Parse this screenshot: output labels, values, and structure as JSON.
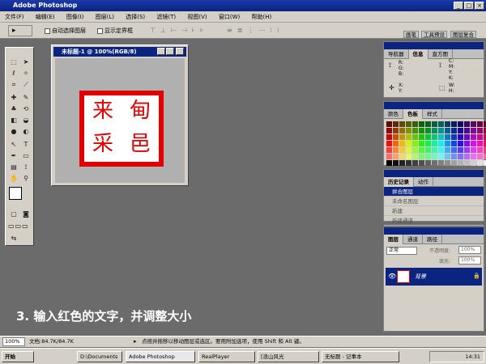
{
  "window": {
    "title": "Adobe Photoshop",
    "min": "_",
    "max": "□",
    "close": "×"
  },
  "menu": [
    "文件(F)",
    "编辑(E)",
    "图像(I)",
    "图层(L)",
    "选择(S)",
    "滤镜(T)",
    "视图(V)",
    "窗口(W)",
    "帮助(H)"
  ],
  "options": {
    "auto_select": "自动选择图层",
    "show_bounds": "显示定界框",
    "tabs": [
      "画笔",
      "工具预设",
      "图层复合"
    ]
  },
  "document": {
    "title": "未标题-1 @ 100%(RGB/8)",
    "seal_chars": [
      "来",
      "甸",
      "采",
      "邑"
    ]
  },
  "info_panel": {
    "tabs": [
      "导航器",
      "信息",
      "直方图"
    ],
    "labels": [
      "R:",
      "G:",
      "B:",
      "C:",
      "M:",
      "Y:",
      "K:",
      "X:",
      "Y:",
      "W:",
      "H:"
    ]
  },
  "color_panel": {
    "tabs": [
      "颜色",
      "色板",
      "样式"
    ]
  },
  "history_panel": {
    "tabs": [
      "历史记录",
      "动作"
    ],
    "items": [
      "拼合图层",
      "未命名图层",
      "新建",
      "新建通道"
    ]
  },
  "layers_panel": {
    "tabs": [
      "图层",
      "通道",
      "路径"
    ],
    "blend": "正常",
    "opacity_label": "不透明度:",
    "opacity": "100%",
    "fill_label": "填充:",
    "fill": "100%",
    "layer_name": "背景"
  },
  "status": {
    "zoom": "100%",
    "doc": "文档:84.7K/84.7K",
    "hint": "点按并拖移以移动图层或选区。要用附加选项，使用 Shift 和 Alt 键。"
  },
  "taskbar": {
    "start": "开始",
    "tasks": [
      "D:\\Documents",
      "Adobe Photoshop",
      "RealPlayer",
      "[浪山风光",
      "无标题 - 记事本"
    ],
    "clock": "14:31"
  },
  "caption": "3. 输入红色的文字，并调整大小"
}
